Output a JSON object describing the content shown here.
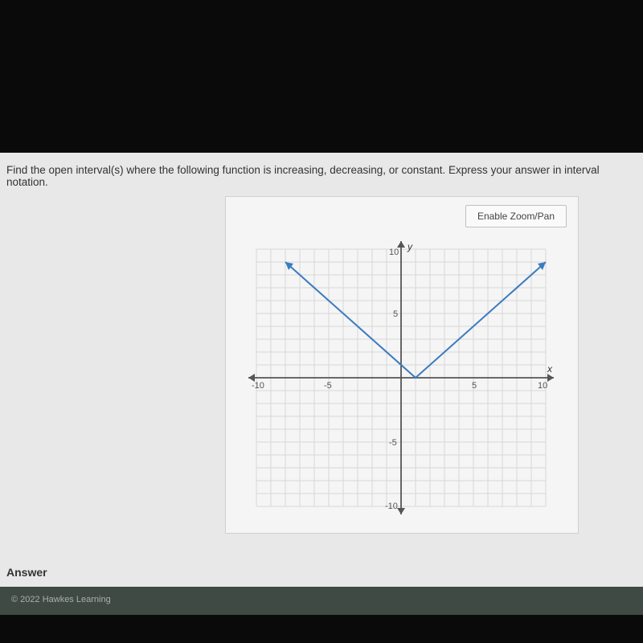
{
  "question": {
    "text": "Find the open interval(s) where the following function is increasing, decreasing, or constant. Express your answer in interval notation."
  },
  "graph": {
    "zoom_button": "Enable Zoom/Pan",
    "xlabel": "x",
    "ylabel": "y",
    "xticks": {
      "neg10": "-10",
      "neg5": "-5",
      "pos5": "5",
      "pos10": "10"
    },
    "yticks": {
      "pos10": "10",
      "pos5": "5",
      "neg5": "-5",
      "neg10": "-10"
    }
  },
  "answer": {
    "label": "Answer"
  },
  "footer": {
    "copyright": "© 2022 Hawkes Learning"
  },
  "chart_data": {
    "type": "line",
    "title": "",
    "xlabel": "x",
    "ylabel": "y",
    "xlim": [
      -10,
      10
    ],
    "ylim": [
      -10,
      10
    ],
    "series": [
      {
        "name": "function",
        "x": [
          -8,
          1,
          10
        ],
        "y": [
          9,
          0,
          9
        ]
      }
    ]
  }
}
